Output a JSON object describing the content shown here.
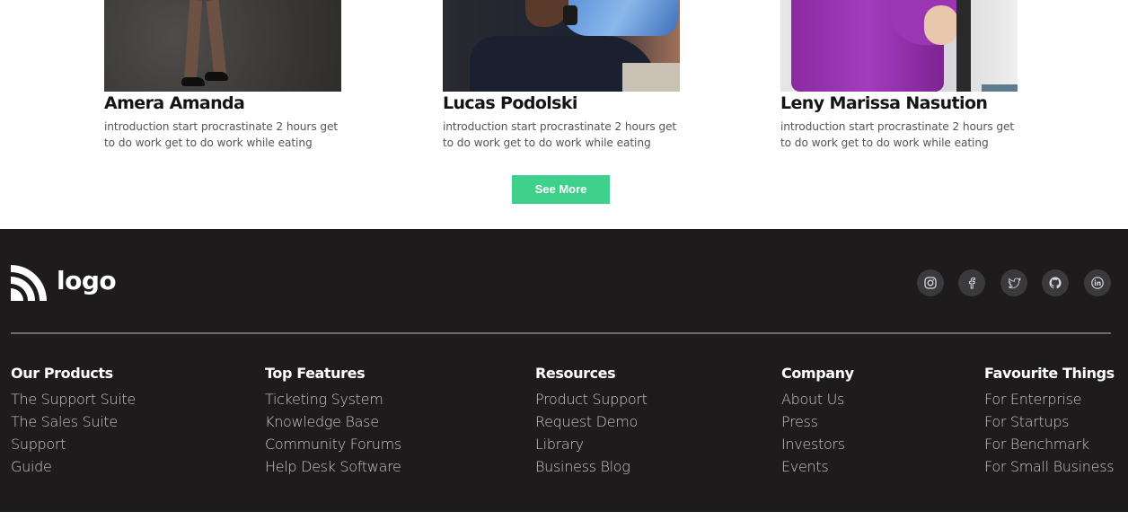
{
  "team": {
    "members": [
      {
        "name": "Amera Amanda",
        "description": "introduction start procrastinate 2 hours get to do work get to do work while eating"
      },
      {
        "name": "Lucas Podolski",
        "description": "introduction start procrastinate 2 hours get to do work get to do work while eating"
      },
      {
        "name": "Leny Marissa Nasution",
        "description": "introduction start procrastinate 2 hours get to do work get to do work while eating"
      }
    ],
    "see_more_label": "See More"
  },
  "footer": {
    "logo_text": "logo",
    "socials": [
      "instagram-icon",
      "facebook-icon",
      "twitter-icon",
      "github-icon",
      "linkedin-icon"
    ],
    "columns": [
      {
        "title": "Our Products",
        "links": [
          "The Support Suite",
          "The Sales Suite",
          "Support",
          "Guide"
        ]
      },
      {
        "title": "Top Features",
        "links": [
          "Ticketing System",
          "Knowledge Base",
          "Community Forums",
          "Help Desk Software"
        ]
      },
      {
        "title": "Resources",
        "links": [
          "Product Support",
          "Request Demo",
          "Library",
          "Business Blog"
        ]
      },
      {
        "title": "Company",
        "links": [
          "About Us",
          "Press",
          "Investors",
          "Events"
        ]
      },
      {
        "title": "Favourite Things",
        "links": [
          "For Enterprise",
          "For Startups",
          "For Benchmark",
          "For Small Business"
        ]
      }
    ]
  },
  "colors": {
    "accent": "#3fd08c",
    "footer_bg": "#1d1b1c",
    "social_bg": "#3a3a3c"
  }
}
